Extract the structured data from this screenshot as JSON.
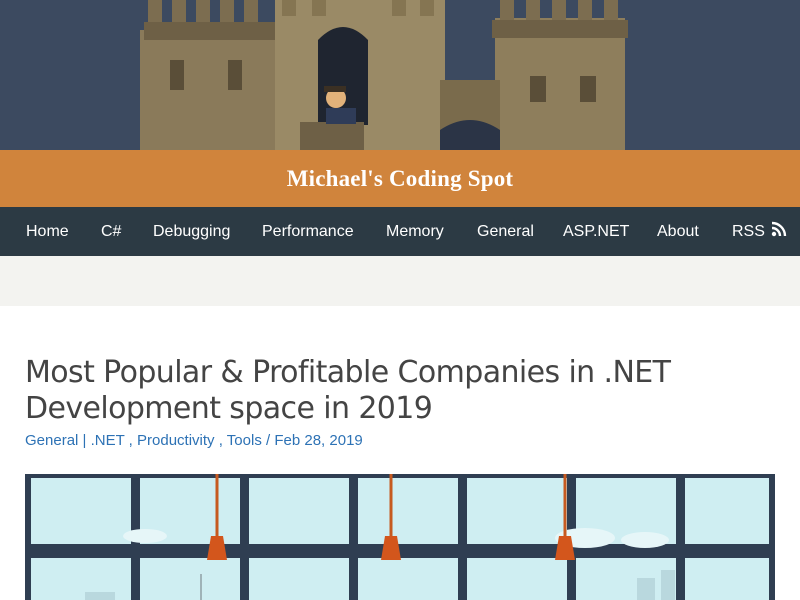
{
  "site": {
    "title": "Michael's Coding Spot"
  },
  "nav": {
    "items": [
      {
        "label": "Home"
      },
      {
        "label": "C#"
      },
      {
        "label": "Debugging"
      },
      {
        "label": "Performance"
      },
      {
        "label": "Memory"
      },
      {
        "label": "General"
      },
      {
        "label": "ASP.NET"
      },
      {
        "label": "About"
      },
      {
        "label": "RSS",
        "icon": "rss-icon"
      }
    ]
  },
  "post": {
    "title": "Most Popular & Profitable Companies in .NET Development space in 2019",
    "categories": [
      "General",
      ".NET",
      "Productivity",
      "Tools"
    ],
    "date": "Feb 28, 2019"
  },
  "colors": {
    "header_bg": "#3c4a60",
    "title_band": "#d0843c",
    "nav_bg": "#2c3a44",
    "link": "#2d72b5"
  }
}
